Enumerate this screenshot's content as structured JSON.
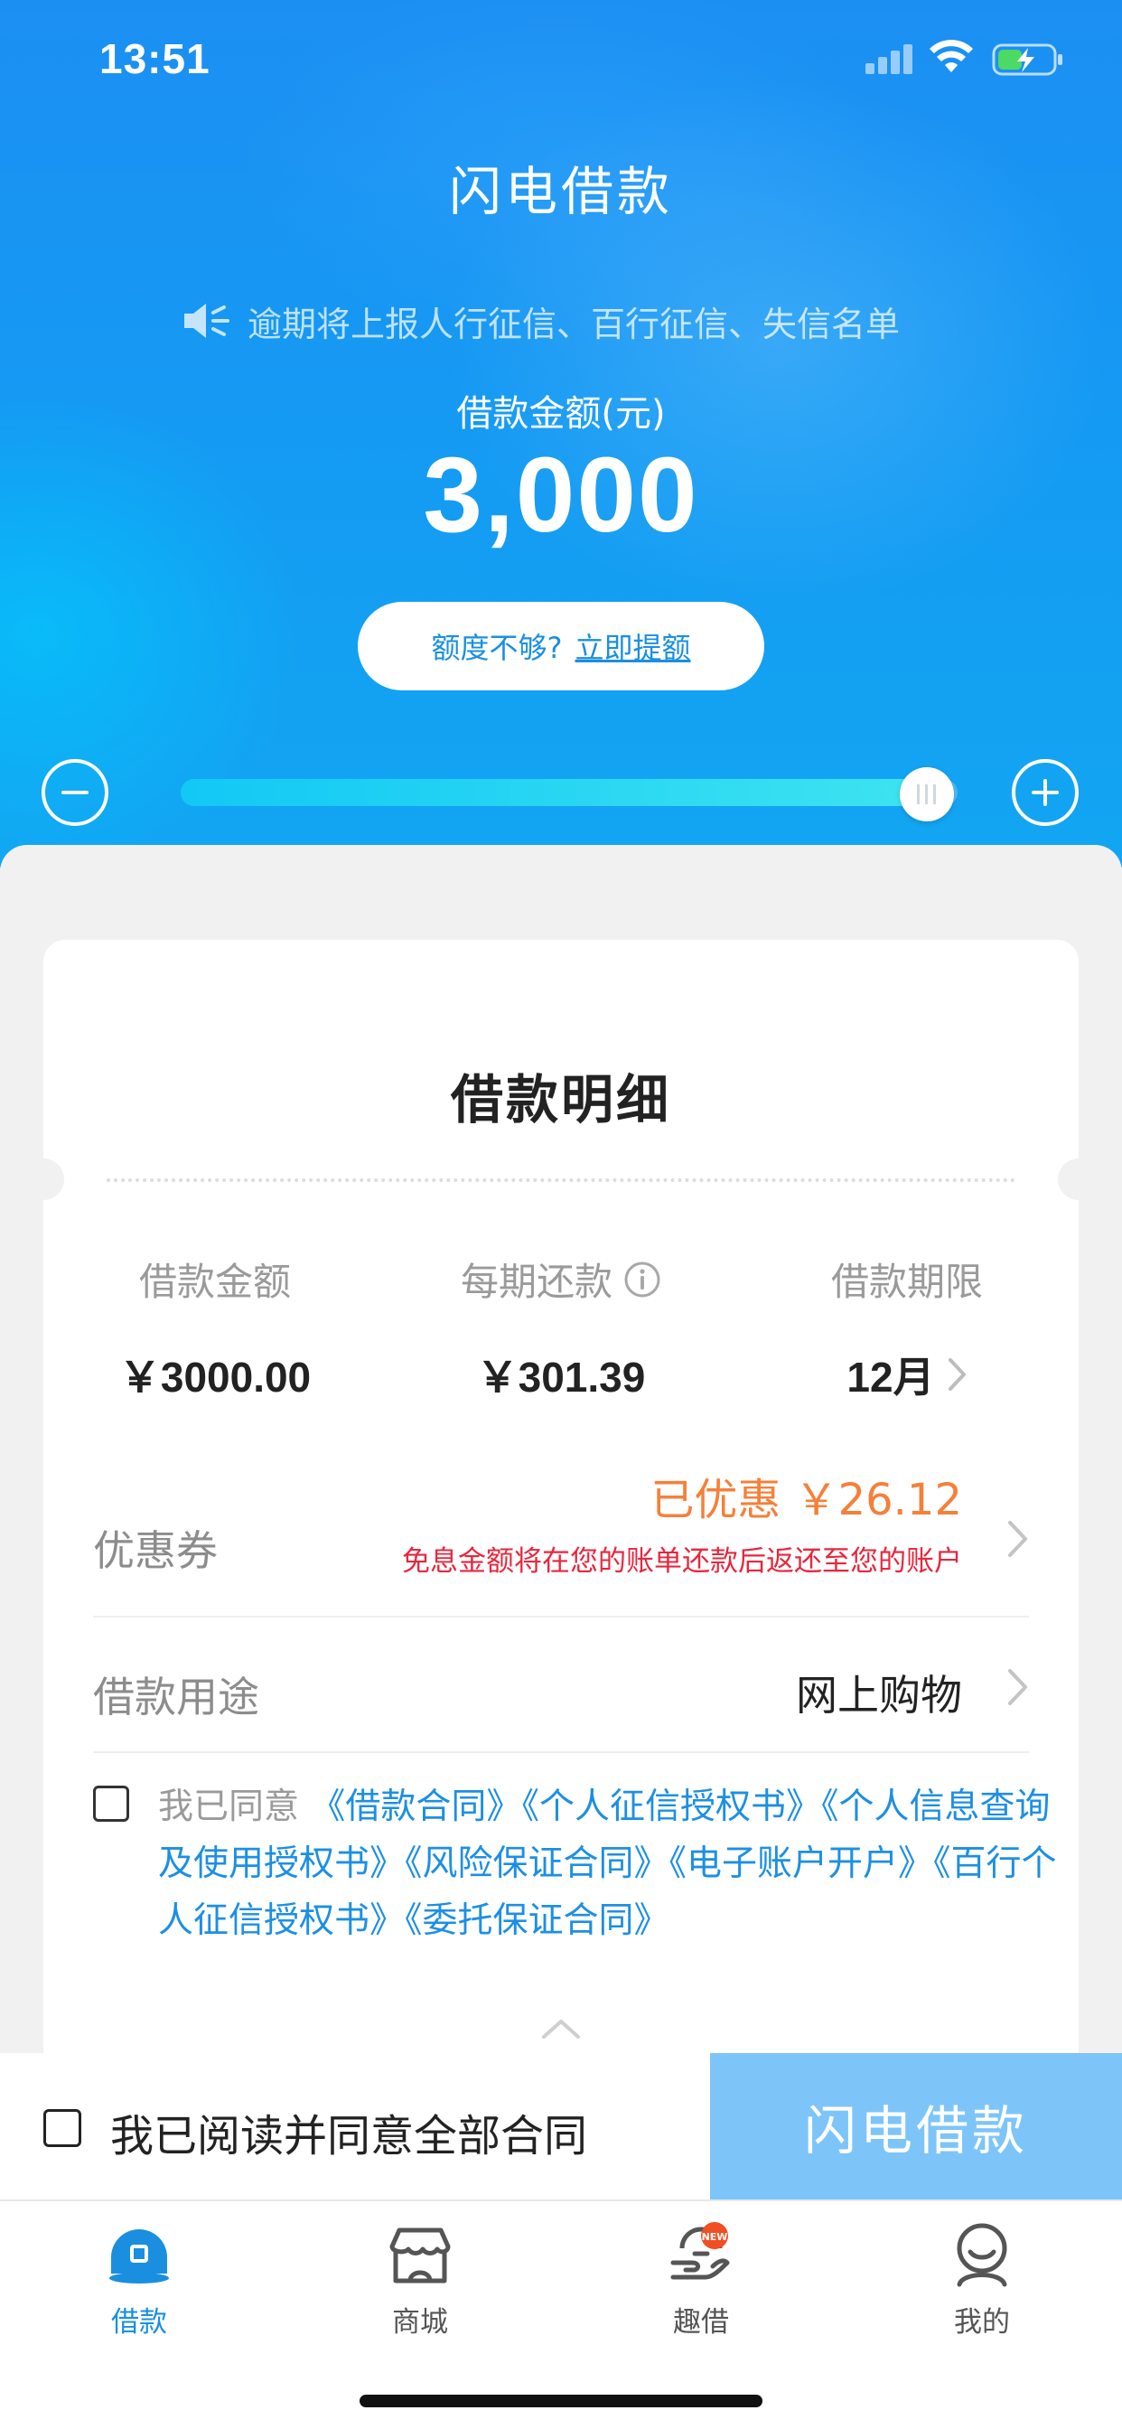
{
  "status_bar": {
    "time": "13:51"
  },
  "header": {
    "title": "闪电借款"
  },
  "notice": {
    "text": "逾期将上报人行征信、百行征信、失信名单"
  },
  "amount": {
    "label": "借款金额(元)",
    "value": "3,000",
    "slider_fraction": 0.96
  },
  "quota": {
    "prefix": "额度不够?",
    "link": "立即提额"
  },
  "detail": {
    "title": "借款明细",
    "stats": [
      {
        "label": "借款金额",
        "value": "￥3000.00"
      },
      {
        "label": "每期还款",
        "value": "￥301.39"
      },
      {
        "label": "借款期限",
        "value": "12月"
      }
    ],
    "coupon": {
      "label": "优惠券",
      "amount": "已优惠 ￥26.12",
      "note": "免息金额将在您的账单还款后返还至您的账户"
    },
    "purpose": {
      "label": "借款用途",
      "value": "网上购物"
    },
    "agreement": {
      "prefix": "我已同意",
      "links": [
        "《借款合同》",
        "《个人征信授权书》",
        "《个人信息查询及使用授权书》",
        "《风险保证合同》",
        "《电子账户开户》",
        "《百行个人征信授权书》",
        "《委托保证合同》"
      ]
    }
  },
  "action_bar": {
    "agree_all_label": "我已阅读并同意全部合同",
    "submit_label": "闪电借款"
  },
  "tabs": [
    {
      "label": "借款",
      "icon": "loan-icon",
      "active": true
    },
    {
      "label": "商城",
      "icon": "store-icon",
      "active": false
    },
    {
      "label": "趣借",
      "icon": "fun-borrow-icon",
      "active": false,
      "badge": "NEW"
    },
    {
      "label": "我的",
      "icon": "profile-icon",
      "active": false
    }
  ],
  "colors": {
    "primary": "#1599f3",
    "accent_link": "#1d8fe3",
    "coupon": "#f5803a",
    "warning": "#e8263c",
    "submit_disabled": "#7dc5f9"
  }
}
